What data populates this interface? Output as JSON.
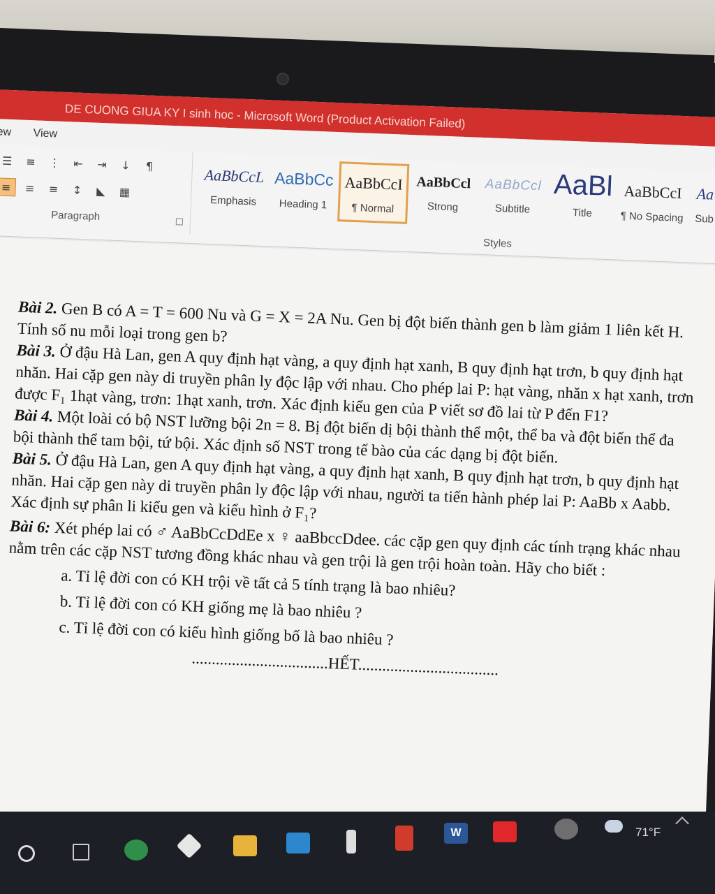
{
  "window": {
    "title": "DE CUONG GIUA KY I sinh hoc - Microsoft Word (Product Activation Failed)"
  },
  "menu": {
    "items": [
      "ew",
      "View"
    ]
  },
  "ribbon": {
    "paragraph_label": "Paragraph",
    "styles_label": "Styles",
    "styles": [
      {
        "sample": "AaBbCcL",
        "name": "Emphasis"
      },
      {
        "sample": "AaBbCc",
        "name": "Heading 1"
      },
      {
        "sample": "AaBbCcI",
        "name": "¶ Normal"
      },
      {
        "sample": "AaBbCcl",
        "name": "Strong"
      },
      {
        "sample": "AaBbCcl",
        "name": "Subtitle"
      },
      {
        "sample": "AaBl",
        "name": "Title"
      },
      {
        "sample": "AaBbCcI",
        "name": "¶ No Spacing"
      },
      {
        "sample": "Aa",
        "name": "Sub"
      }
    ]
  },
  "document": {
    "bai2_label": "Bài 2.",
    "bai2_text": " Gen B có A = T = 600 Nu và G = X = 2A Nu. Gen bị đột biến thành gen b làm giảm 1 liên kết H. Tính số nu mỗi loại trong gen b?",
    "bai3_label": "Bài 3.",
    "bai3_text": " Ở đậu Hà Lan, gen A quy định hạt vàng, a quy định hạt xanh, B quy định hạt trơn, b quy định hạt nhăn. Hai cặp gen này di truyền phân ly độc lập với nhau. Cho phép lai P: hạt vàng, nhăn x hạt xanh, trơn được F₁ 1hạt vàng, trơn: 1hạt xanh, trơn. Xác định kiểu gen của P viết sơ đồ lai từ P đến F1?",
    "bai4_label": "Bài 4.",
    "bai4_text": " Một loài có bộ NST lưỡng bội 2n = 8. Bị đột biến dị bội thành thể một, thể ba và đột biến thể đa bội thành thể tam bội, tứ bội. Xác định số NST trong tế bào của các dạng bị đột biến.",
    "bai5_label": "Bài 5.",
    "bai5_text": " Ở đậu Hà Lan, gen A quy định hạt vàng, a quy định hạt xanh, B quy định hạt trơn, b quy định hạt nhăn. Hai cặp gen này di truyền phân ly độc lập với nhau, người ta tiến hành phép lai P: AaBb  x  Aabb. Xác định sự phân li kiểu gen và kiểu hình ở F₁?",
    "bai6_label": "Bài 6:",
    "bai6_text": " Xét phép lai có ♂ AaBbCcDdEe    x    ♀ aaBbccDdee.  các cặp gen quy định các tính trạng khác nhau nằm trên các cặp NST tương đồng khác nhau và gen trội là gen trội hoàn toàn. Hãy cho biết :",
    "q_a": "a. Tỉ lệ đời con có KH trội về tất cả 5 tính trạng là bao nhiêu?",
    "q_b": "b. Tỉ lệ đời con có KH giống mẹ là bao nhiêu ?",
    "q_c": "c. Tỉ lệ đời con có kiểu hình giống bố là bao nhiêu ?",
    "end": "..................................HẾT..................................."
  },
  "taskbar": {
    "temperature": "71°F"
  },
  "colors": {
    "titlebar": "#d2302c",
    "ribbon": "#f4f4f4",
    "selected_style": "#e0a04f",
    "taskbar": "#1d1f26"
  }
}
